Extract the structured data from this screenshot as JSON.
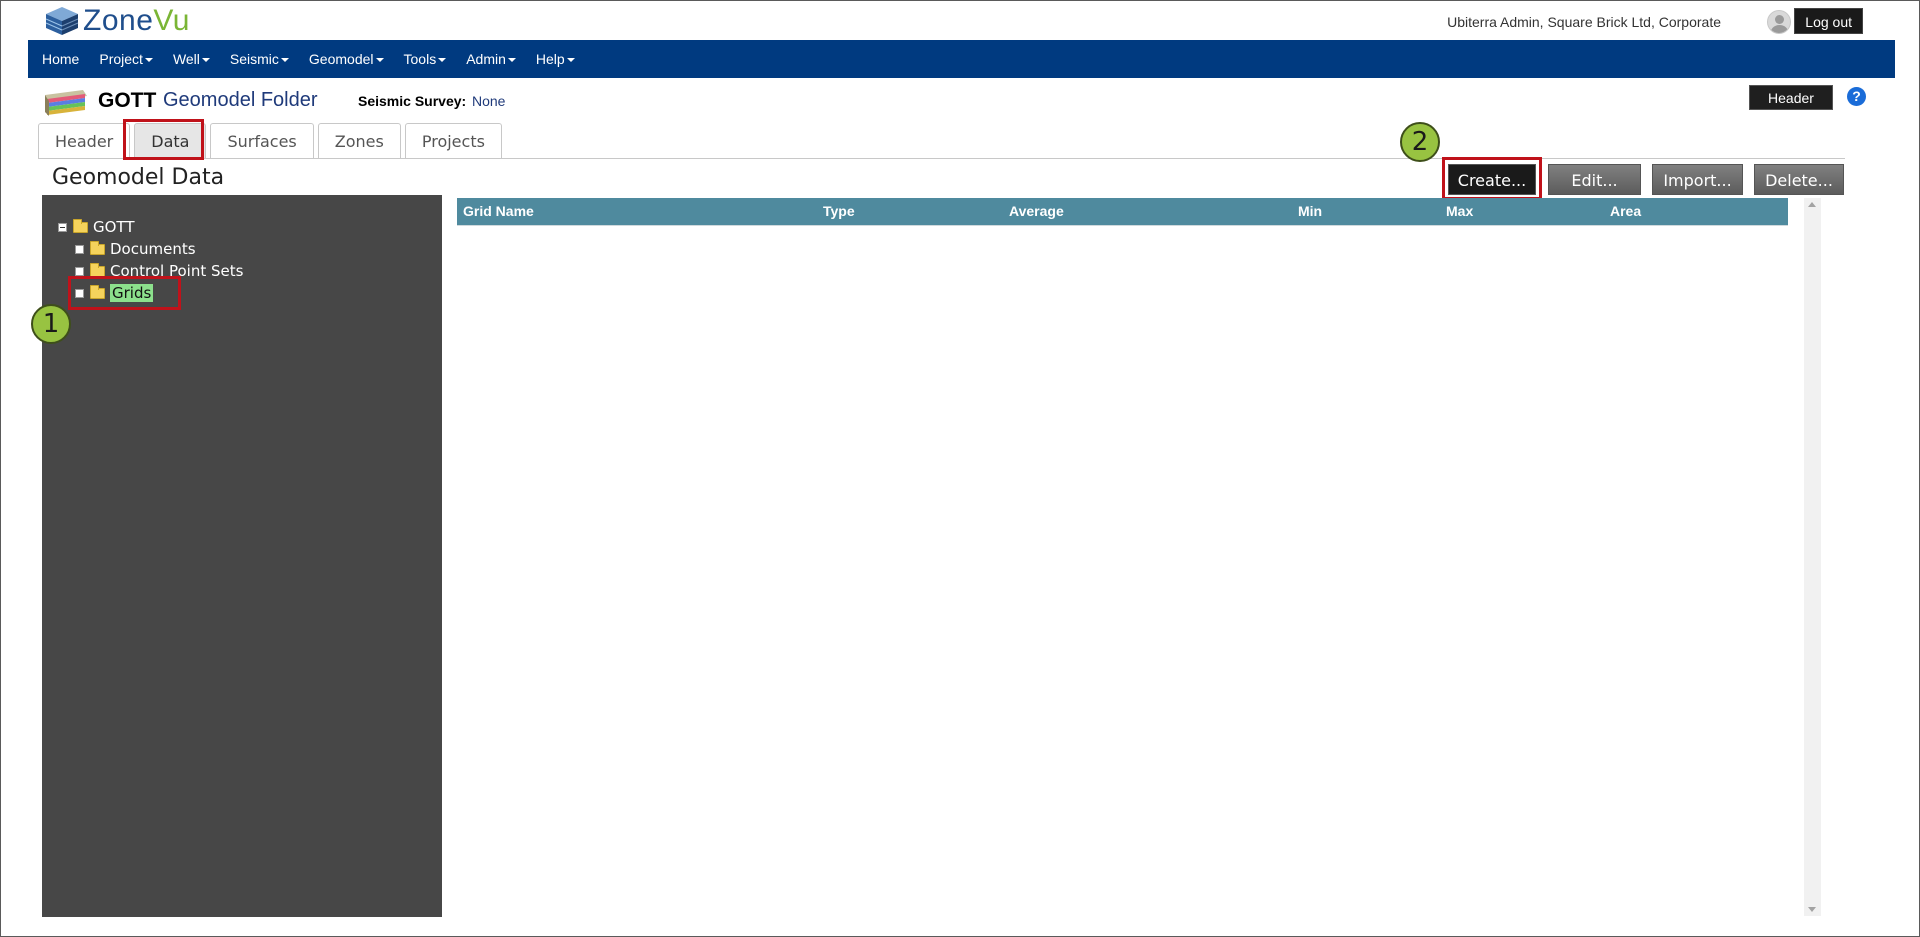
{
  "app": {
    "logo_prefix": "Zone",
    "logo_suffix": "Vu"
  },
  "user": {
    "info": "Ubiterra Admin, Square Brick Ltd, Corporate",
    "logout_label": "Log out"
  },
  "nav": {
    "items": [
      {
        "label": "Home",
        "has_caret": false
      },
      {
        "label": "Project",
        "has_caret": true
      },
      {
        "label": "Well",
        "has_caret": true
      },
      {
        "label": "Seismic",
        "has_caret": true
      },
      {
        "label": "Geomodel",
        "has_caret": true
      },
      {
        "label": "Tools",
        "has_caret": true
      },
      {
        "label": "Admin",
        "has_caret": true
      },
      {
        "label": "Help",
        "has_caret": true
      }
    ]
  },
  "page": {
    "name": "GOTT",
    "type": "Geomodel Folder",
    "seismic_label": "Seismic Survey:",
    "seismic_value": "None",
    "header_button": "Header",
    "help_label": "?"
  },
  "tabs": [
    {
      "label": "Header",
      "active": false
    },
    {
      "label": "Data",
      "active": true
    },
    {
      "label": "Surfaces",
      "active": false
    },
    {
      "label": "Zones",
      "active": false
    },
    {
      "label": "Projects",
      "active": false
    }
  ],
  "section": {
    "title": "Geomodel Data",
    "buttons": {
      "create": "Create...",
      "edit": "Edit...",
      "import": "Import...",
      "delete": "Delete..."
    }
  },
  "tree": {
    "root": "GOTT",
    "children": [
      "Documents",
      "Control Point Sets",
      "Grids"
    ],
    "selected": "Grids"
  },
  "grid": {
    "columns": [
      "Grid Name",
      "Type",
      "Average",
      "Min",
      "Max",
      "Area"
    ],
    "rows": []
  },
  "annotations": {
    "marker1": "1",
    "marker2": "2"
  },
  "colors": {
    "nav": "#003a80",
    "highlight": "#c0121a",
    "marker": "#98c341",
    "grid_header": "#4f8a9e"
  }
}
